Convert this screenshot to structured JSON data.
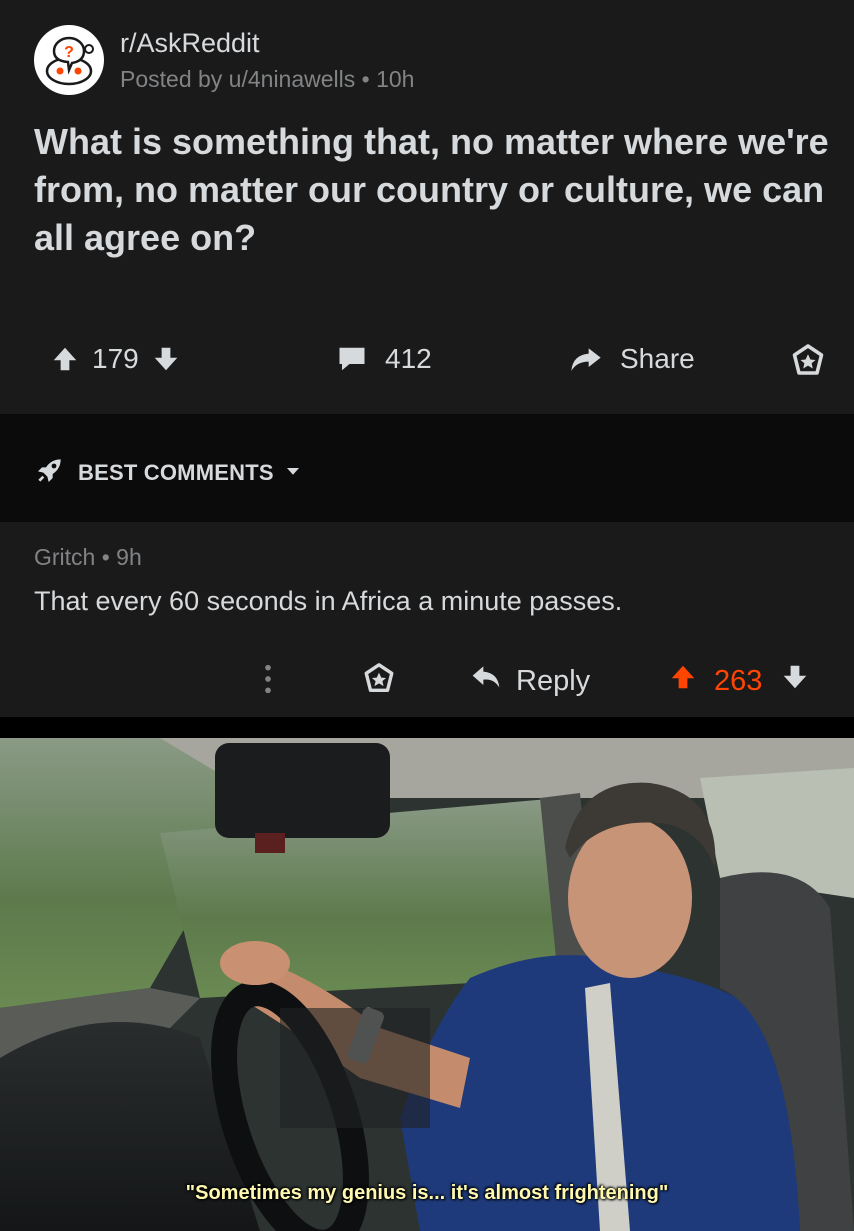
{
  "post": {
    "subreddit": "r/AskReddit",
    "posted_by": "Posted by u/4ninawells • 10h",
    "title": "What is something that, no matter where we're from, no matter our country or culture, we can all agree on?",
    "score": "179",
    "comments": "412",
    "share_label": "Share"
  },
  "sort": {
    "label": "BEST COMMENTS"
  },
  "comment": {
    "meta": "Gritch • 9h",
    "body": "That every 60 seconds in Africa a minute passes.",
    "reply_label": "Reply",
    "score": "263"
  },
  "meme": {
    "caption": "\"Sometimes my genius is... it's almost frightening\""
  },
  "colors": {
    "background": "#1a1a1b",
    "upvote_accent": "#ff4500",
    "muted_text": "#818384"
  }
}
